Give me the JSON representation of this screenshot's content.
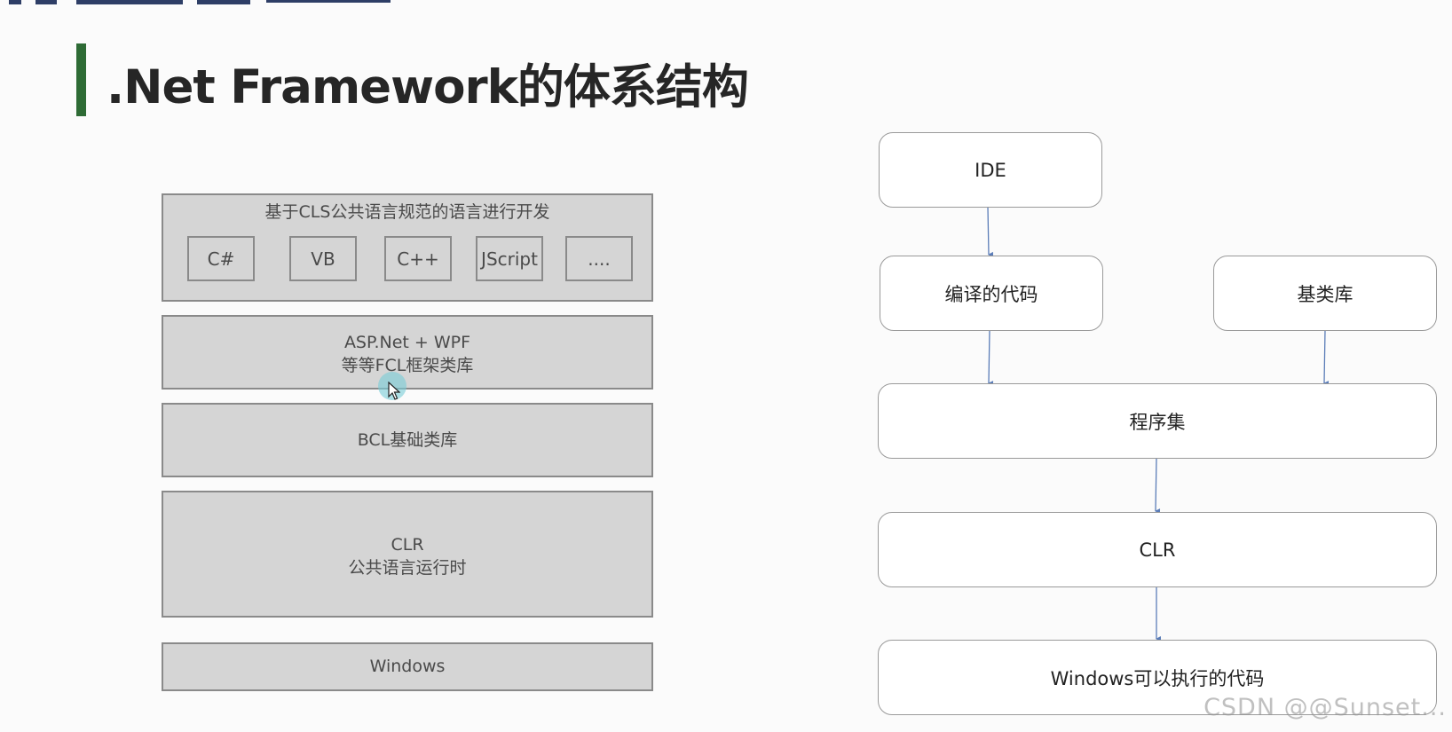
{
  "page_title": ".Net Framework的体系结构",
  "stack": {
    "top_caption": "基于CLS公共语言规范的语言进行开发",
    "languages": [
      "C#",
      "VB",
      "C++",
      "JScript",
      "...."
    ],
    "fcl": [
      "ASP.Net + WPF",
      "等等FCL框架类库"
    ],
    "bcl": "BCL基础类库",
    "clr": [
      "CLR",
      "公共语言运行时"
    ],
    "os": "Windows"
  },
  "flow": {
    "ide": "IDE",
    "compiled": "编译的代码",
    "base_library": "基类库",
    "assembly": "程序集",
    "clr": "CLR",
    "executable": "Windows可以执行的代码"
  },
  "watermark": "CSDN @@Sunset...",
  "colors": {
    "title_accent": "#2e6b35",
    "layer_fill": "#d5d5d5",
    "arrow": "#5b7db8",
    "topbar": "#2e3e66"
  }
}
